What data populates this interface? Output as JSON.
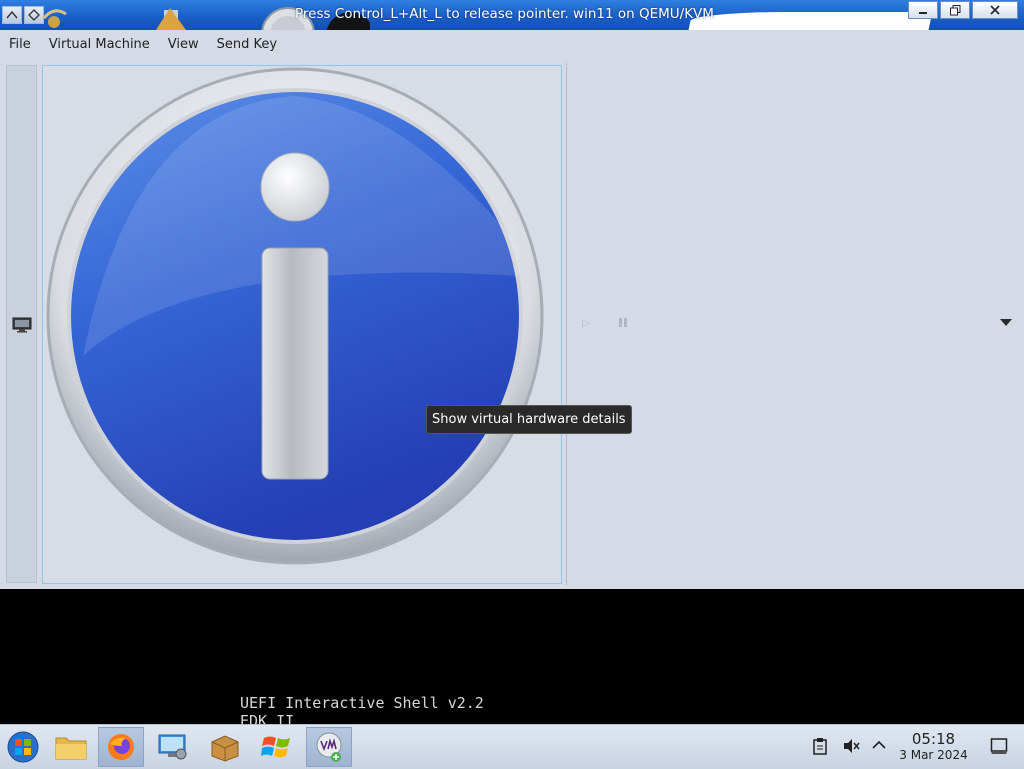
{
  "window": {
    "title": "Press Control_L+Alt_L to release pointer. win11 on QEMU/KVM",
    "buttons": [
      "minimize",
      "maximize",
      "close"
    ]
  },
  "menu": {
    "items": [
      "File",
      "Virtual Machine",
      "View",
      "Send Key"
    ]
  },
  "toolbar": {
    "details_tooltip": "Show virtual hardware details"
  },
  "console": {
    "lines": [
      "UEFI Interactive Shell v2.2",
      "EDK II"
    ]
  },
  "taskbar": {
    "apps": [
      "start-orb",
      "file-manager",
      "firefox",
      "system-settings",
      "package-manager",
      "windows-logo",
      "virt-manager"
    ],
    "clock_time": "05:18",
    "clock_date": "3 Mar 2024"
  },
  "colors": {
    "titlebar": "#1a5fc8",
    "menubar_bg": "#d4dbe6",
    "info_blue": "#2d55c8",
    "tooltip_bg": "#2a2a2a"
  }
}
